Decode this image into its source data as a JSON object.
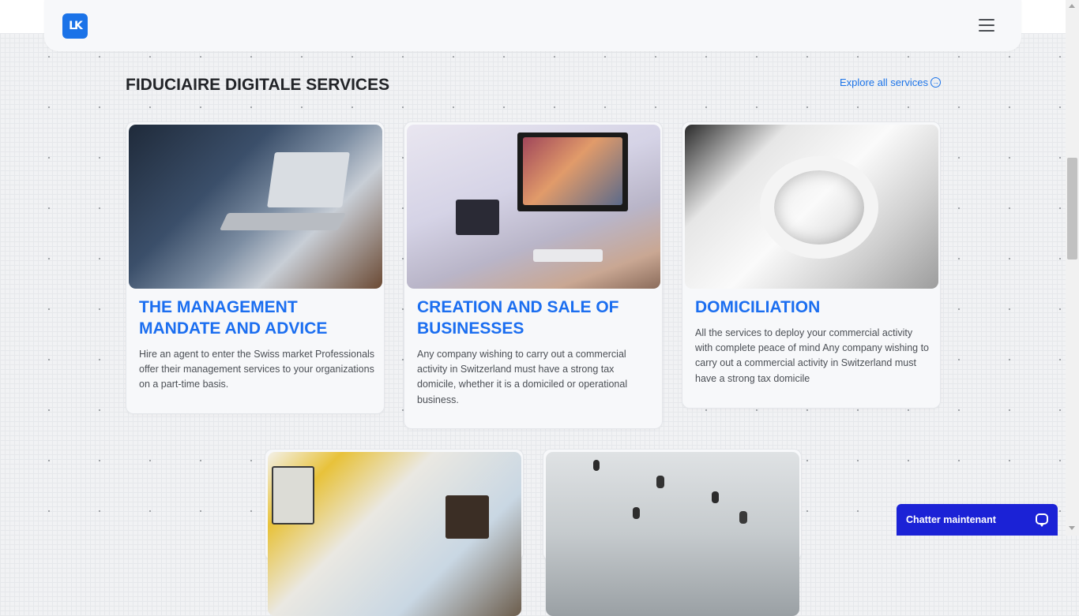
{
  "header": {
    "logo_text": "LK",
    "menu_icon": "hamburger-menu-icon"
  },
  "section": {
    "title": "FIDUCIAIRE DIGITALE SERVICES",
    "explore_label": "Explore all services",
    "explore_icon": "arrow-right-circle-icon"
  },
  "cards": [
    {
      "title": "THE MANAGEMENT MANDATE AND ADVICE",
      "description": "Hire an agent to enter the Swiss market Professionals offer their management services to your organizations on a part-time basis."
    },
    {
      "title": "CREATION AND SALE OF BUSINESSES",
      "description": "Any company wishing to carry out a commercial activity in Switzerland must have a strong tax domicile, whether it is a domiciled or operational business."
    },
    {
      "title": "DOMICILIATION",
      "description": "All the services to deploy your commercial activity with complete peace of mind Any company wishing to carry out a commercial activity in Switzerland must have a strong tax domicile"
    }
  ],
  "chat": {
    "label": "Chatter maintenant",
    "icon": "chat-bubble-icon",
    "color": "#1b22d6"
  },
  "colors": {
    "accent": "#1b6ef0",
    "logo_bg": "#1b73e8"
  }
}
